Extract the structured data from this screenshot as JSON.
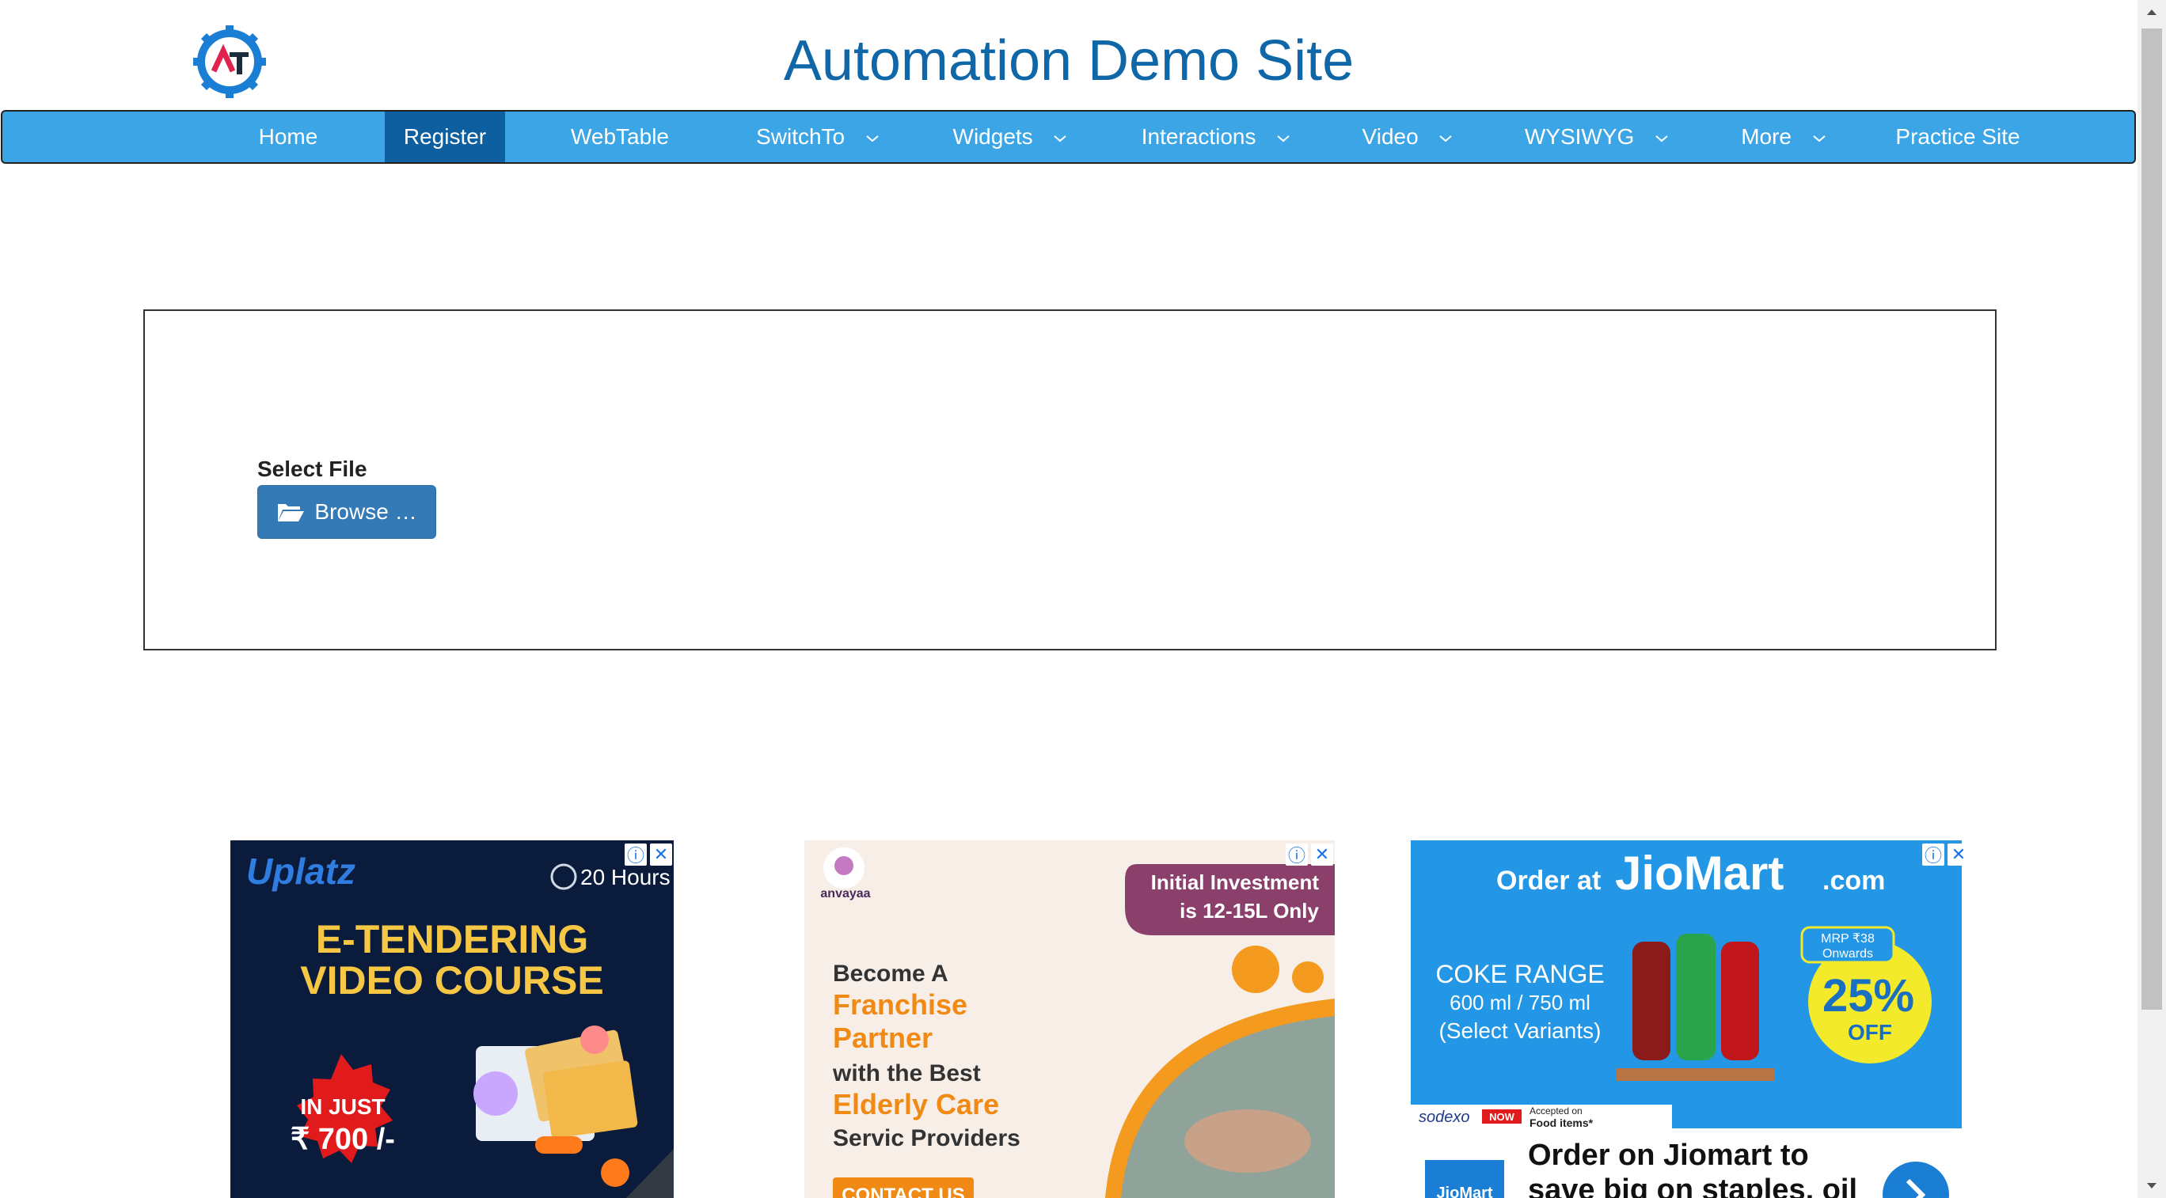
{
  "header": {
    "title": "Automation Demo Site",
    "logo_letters": "AT"
  },
  "nav": {
    "items": [
      {
        "label": "Home",
        "dropdown": false,
        "active": false
      },
      {
        "label": "Register",
        "dropdown": false,
        "active": true
      },
      {
        "label": "WebTable",
        "dropdown": false,
        "active": false
      },
      {
        "label": "SwitchTo",
        "dropdown": true,
        "active": false
      },
      {
        "label": "Widgets",
        "dropdown": true,
        "active": false
      },
      {
        "label": "Interactions",
        "dropdown": true,
        "active": false
      },
      {
        "label": "Video",
        "dropdown": true,
        "active": false
      },
      {
        "label": "WYSIWYG",
        "dropdown": true,
        "active": false
      },
      {
        "label": "More",
        "dropdown": true,
        "active": false
      },
      {
        "label": "Practice Site",
        "dropdown": false,
        "active": false
      }
    ]
  },
  "upload": {
    "label": "Select File",
    "button_label": "Browse …"
  },
  "ads": {
    "uplatz": {
      "brand": "Uplatz",
      "duration": "20 Hours",
      "headline1": "E-TENDERING",
      "headline2": "VIDEO COURSE",
      "price_line1": "IN JUST",
      "price_line2": "₹ 700 /-"
    },
    "anvayaa": {
      "brand": "anvayaa",
      "badge_line1": "Initial Investment",
      "badge_line2": "is 12-15L Only",
      "line1": "Become A",
      "line2": "Franchise",
      "line3": "Partner",
      "line4": "with the Best",
      "line5": "Elderly Care",
      "line6": "Servic Providers",
      "cta": "CONTACT US"
    },
    "jiomart": {
      "order_at": "Order at",
      "brand": "JioMart",
      "dotcom": ".com",
      "range": "COKE RANGE",
      "sizes": "600 ml / 750 ml",
      "variants": "(Select Variants)",
      "mrp1": "MRP ₹38",
      "mrp2": "Onwards",
      "discount": "25%",
      "off": "OFF",
      "sodexo": "sodexo",
      "now": "NOW",
      "accepted1": "Accepted on",
      "accepted2": "Food items*",
      "text_line1": "Order on Jiomart to",
      "text_line2": "save big on staples, oil",
      "logo_text": "JioMart"
    }
  },
  "colors": {
    "nav_bg": "#3ca5e6",
    "nav_active": "#0e5fa0",
    "title": "#1067a8",
    "button": "#337ab7"
  },
  "icons": {
    "browse": "folder-open-icon",
    "dropdown": "chevron-down-icon",
    "ad_info": "info-icon",
    "ad_close": "close-icon"
  }
}
